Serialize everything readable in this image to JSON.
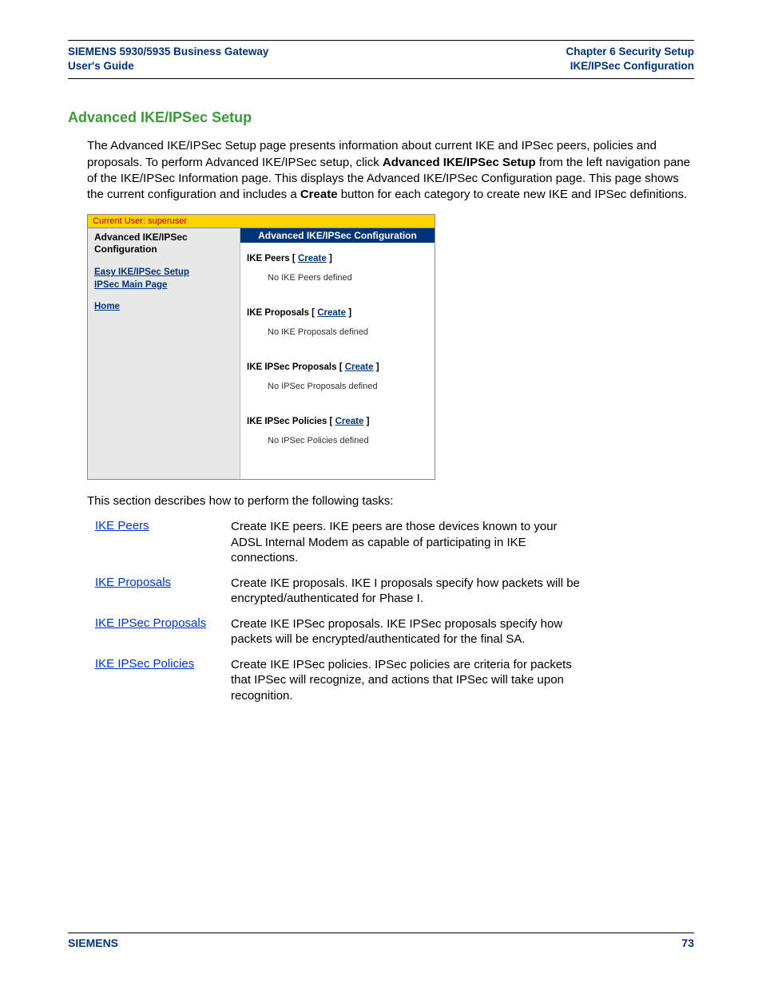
{
  "header": {
    "left_line1": "SIEMENS 5930/5935 Business Gateway",
    "left_line2": "User's Guide",
    "right_line1": "Chapter 6  Security Setup",
    "right_line2": "IKE/IPSec Configuration"
  },
  "title": "Advanced IKE/IPSec Setup",
  "intro_part1": "The Advanced IKE/IPSec Setup page presents information about current IKE and IPSec peers, policies and proposals. To perform Advanced IKE/IPSec setup, click ",
  "intro_bold1": "Advanced IKE/IPSec Setup",
  "intro_part2": " from the left navigation pane of the IKE/IPSec Information page. This displays the Advanced IKE/IPSec Configuration page. This page shows the current configuration and includes a ",
  "intro_bold2": "Create",
  "intro_part3": " button for each category to create new IKE and IPSec definitions.",
  "panel": {
    "user_bar": "Current User: superuser",
    "sidebar_title_l1": "Advanced IKE/IPSec",
    "sidebar_title_l2": "Configuration",
    "links": {
      "easy": "Easy IKE/IPSec Setup",
      "main": "IPSec Main Page",
      "home": "Home"
    },
    "content_title": "Advanced IKE/IPSec Configuration",
    "sections": [
      {
        "label": "IKE Peers",
        "create": "Create",
        "msg": "No IKE Peers defined"
      },
      {
        "label": "IKE Proposals",
        "create": "Create",
        "msg": "No IKE Proposals defined"
      },
      {
        "label": "IKE IPSec Proposals",
        "create": "Create",
        "msg": "No IPSec Proposals defined"
      },
      {
        "label": "IKE IPSec Policies",
        "create": "Create",
        "msg": "No IPSec Policies defined"
      }
    ]
  },
  "tasks_intro": "This section describes how to perform the following tasks:",
  "tasks": [
    {
      "name": "IKE Peers",
      "desc": "Create IKE peers. IKE peers are those devices known to your ADSL Internal Modem as capable of participating in IKE connections."
    },
    {
      "name": "IKE Proposals",
      "desc": "Create IKE proposals. IKE I proposals specify how packets will be encrypted/authenticated for Phase I."
    },
    {
      "name": "IKE IPSec Proposals",
      "desc": "Create IKE IPSec proposals. IKE IPSec proposals specify how packets will be encrypted/authenticated for the final SA."
    },
    {
      "name": "IKE IPSec Policies",
      "desc": "Create IKE IPSec policies. IPSec policies are criteria for packets that IPSec will recognize, and actions that IPSec will take upon recognition."
    }
  ],
  "footer": {
    "left": "SIEMENS",
    "right": "73"
  }
}
